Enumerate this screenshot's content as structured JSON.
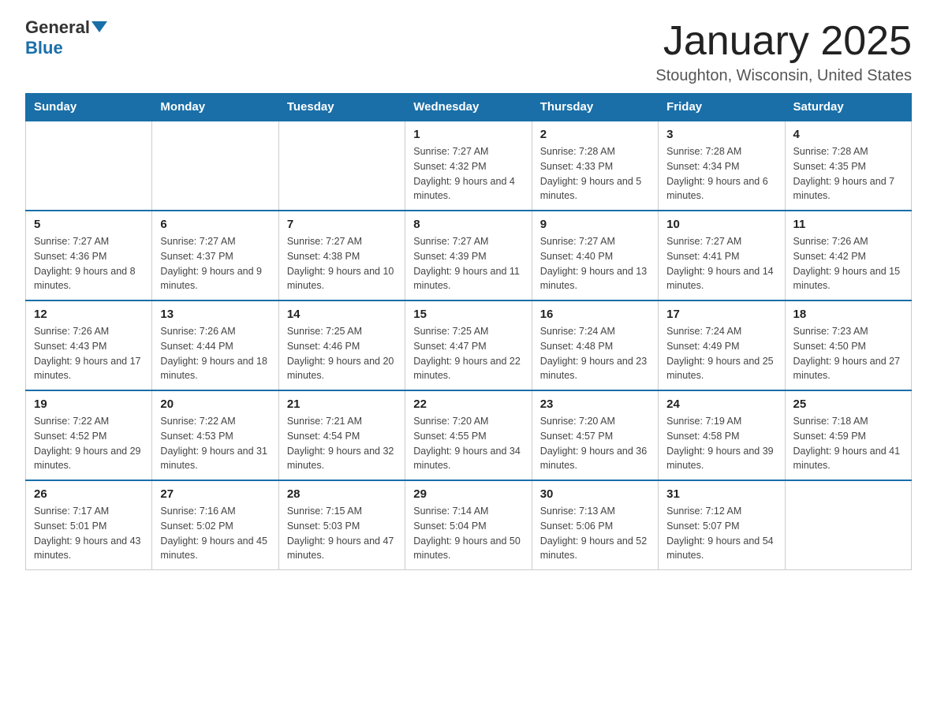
{
  "header": {
    "logo_general": "General",
    "logo_blue": "Blue",
    "title": "January 2025",
    "subtitle": "Stoughton, Wisconsin, United States"
  },
  "weekdays": [
    "Sunday",
    "Monday",
    "Tuesday",
    "Wednesday",
    "Thursday",
    "Friday",
    "Saturday"
  ],
  "weeks": [
    [
      {
        "day": "",
        "info": ""
      },
      {
        "day": "",
        "info": ""
      },
      {
        "day": "",
        "info": ""
      },
      {
        "day": "1",
        "info": "Sunrise: 7:27 AM\nSunset: 4:32 PM\nDaylight: 9 hours and 4 minutes."
      },
      {
        "day": "2",
        "info": "Sunrise: 7:28 AM\nSunset: 4:33 PM\nDaylight: 9 hours and 5 minutes."
      },
      {
        "day": "3",
        "info": "Sunrise: 7:28 AM\nSunset: 4:34 PM\nDaylight: 9 hours and 6 minutes."
      },
      {
        "day": "4",
        "info": "Sunrise: 7:28 AM\nSunset: 4:35 PM\nDaylight: 9 hours and 7 minutes."
      }
    ],
    [
      {
        "day": "5",
        "info": "Sunrise: 7:27 AM\nSunset: 4:36 PM\nDaylight: 9 hours and 8 minutes."
      },
      {
        "day": "6",
        "info": "Sunrise: 7:27 AM\nSunset: 4:37 PM\nDaylight: 9 hours and 9 minutes."
      },
      {
        "day": "7",
        "info": "Sunrise: 7:27 AM\nSunset: 4:38 PM\nDaylight: 9 hours and 10 minutes."
      },
      {
        "day": "8",
        "info": "Sunrise: 7:27 AM\nSunset: 4:39 PM\nDaylight: 9 hours and 11 minutes."
      },
      {
        "day": "9",
        "info": "Sunrise: 7:27 AM\nSunset: 4:40 PM\nDaylight: 9 hours and 13 minutes."
      },
      {
        "day": "10",
        "info": "Sunrise: 7:27 AM\nSunset: 4:41 PM\nDaylight: 9 hours and 14 minutes."
      },
      {
        "day": "11",
        "info": "Sunrise: 7:26 AM\nSunset: 4:42 PM\nDaylight: 9 hours and 15 minutes."
      }
    ],
    [
      {
        "day": "12",
        "info": "Sunrise: 7:26 AM\nSunset: 4:43 PM\nDaylight: 9 hours and 17 minutes."
      },
      {
        "day": "13",
        "info": "Sunrise: 7:26 AM\nSunset: 4:44 PM\nDaylight: 9 hours and 18 minutes."
      },
      {
        "day": "14",
        "info": "Sunrise: 7:25 AM\nSunset: 4:46 PM\nDaylight: 9 hours and 20 minutes."
      },
      {
        "day": "15",
        "info": "Sunrise: 7:25 AM\nSunset: 4:47 PM\nDaylight: 9 hours and 22 minutes."
      },
      {
        "day": "16",
        "info": "Sunrise: 7:24 AM\nSunset: 4:48 PM\nDaylight: 9 hours and 23 minutes."
      },
      {
        "day": "17",
        "info": "Sunrise: 7:24 AM\nSunset: 4:49 PM\nDaylight: 9 hours and 25 minutes."
      },
      {
        "day": "18",
        "info": "Sunrise: 7:23 AM\nSunset: 4:50 PM\nDaylight: 9 hours and 27 minutes."
      }
    ],
    [
      {
        "day": "19",
        "info": "Sunrise: 7:22 AM\nSunset: 4:52 PM\nDaylight: 9 hours and 29 minutes."
      },
      {
        "day": "20",
        "info": "Sunrise: 7:22 AM\nSunset: 4:53 PM\nDaylight: 9 hours and 31 minutes."
      },
      {
        "day": "21",
        "info": "Sunrise: 7:21 AM\nSunset: 4:54 PM\nDaylight: 9 hours and 32 minutes."
      },
      {
        "day": "22",
        "info": "Sunrise: 7:20 AM\nSunset: 4:55 PM\nDaylight: 9 hours and 34 minutes."
      },
      {
        "day": "23",
        "info": "Sunrise: 7:20 AM\nSunset: 4:57 PM\nDaylight: 9 hours and 36 minutes."
      },
      {
        "day": "24",
        "info": "Sunrise: 7:19 AM\nSunset: 4:58 PM\nDaylight: 9 hours and 39 minutes."
      },
      {
        "day": "25",
        "info": "Sunrise: 7:18 AM\nSunset: 4:59 PM\nDaylight: 9 hours and 41 minutes."
      }
    ],
    [
      {
        "day": "26",
        "info": "Sunrise: 7:17 AM\nSunset: 5:01 PM\nDaylight: 9 hours and 43 minutes."
      },
      {
        "day": "27",
        "info": "Sunrise: 7:16 AM\nSunset: 5:02 PM\nDaylight: 9 hours and 45 minutes."
      },
      {
        "day": "28",
        "info": "Sunrise: 7:15 AM\nSunset: 5:03 PM\nDaylight: 9 hours and 47 minutes."
      },
      {
        "day": "29",
        "info": "Sunrise: 7:14 AM\nSunset: 5:04 PM\nDaylight: 9 hours and 50 minutes."
      },
      {
        "day": "30",
        "info": "Sunrise: 7:13 AM\nSunset: 5:06 PM\nDaylight: 9 hours and 52 minutes."
      },
      {
        "day": "31",
        "info": "Sunrise: 7:12 AM\nSunset: 5:07 PM\nDaylight: 9 hours and 54 minutes."
      },
      {
        "day": "",
        "info": ""
      }
    ]
  ]
}
